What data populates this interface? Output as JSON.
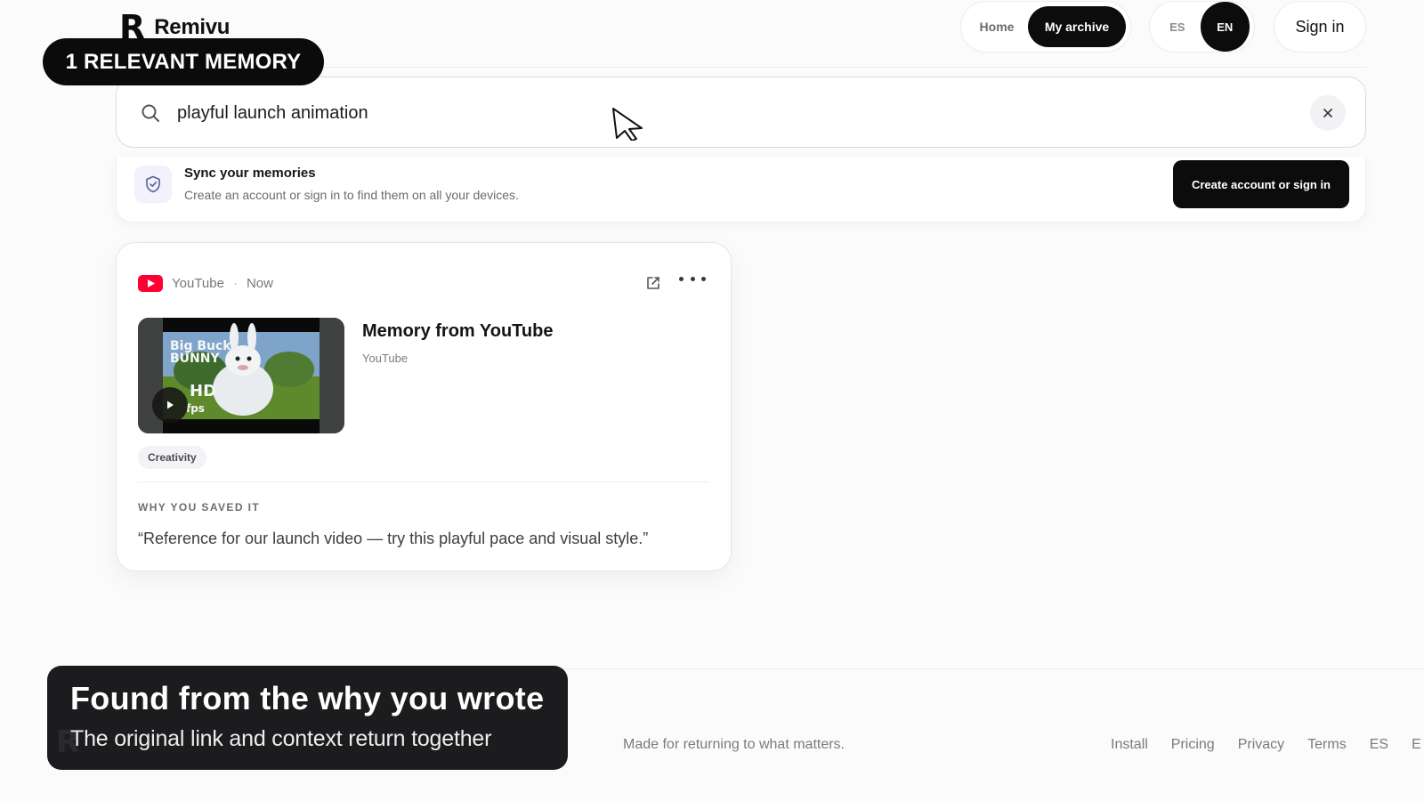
{
  "brand": {
    "mark": "R",
    "name": "Remivu"
  },
  "nav": {
    "home": "Home",
    "archive": "My archive"
  },
  "lang": {
    "es": "ES",
    "en": "EN"
  },
  "header": {
    "sign_in": "Sign in"
  },
  "badge": {
    "label": "1 RELEVANT MEMORY"
  },
  "search": {
    "value": "playful launch animation",
    "clear_icon": "close-icon"
  },
  "sync": {
    "title": "Sync your memories",
    "subtitle": "Create an account or sign in to find them on all your devices.",
    "button": "Create account or sign in"
  },
  "card": {
    "source": "YouTube",
    "separator": "·",
    "time": "Now",
    "title": "Memory from YouTube",
    "subtitle": "YouTube",
    "tag": "Creativity",
    "why_label": "WHY YOU SAVED IT",
    "why_text": "“Reference for our launch video — try this playful pace and visual style.”",
    "thumbnail": {
      "title_line1": "Big Buck",
      "title_line2": "BUNNY",
      "hd": "HD",
      "fps": "fps"
    }
  },
  "footer": {
    "tagline": "Made for returning to what matters.",
    "links": [
      "Install",
      "Pricing",
      "Privacy",
      "Terms",
      "ES",
      "E"
    ]
  },
  "caption": {
    "title": "Found from the why you wrote",
    "subtitle": "The original link and context return together",
    "ghost_mark": "R"
  },
  "colors": {
    "accent": "#0c0c0d",
    "youtube_red": "#ff0033",
    "background": "#fbfbfc"
  }
}
